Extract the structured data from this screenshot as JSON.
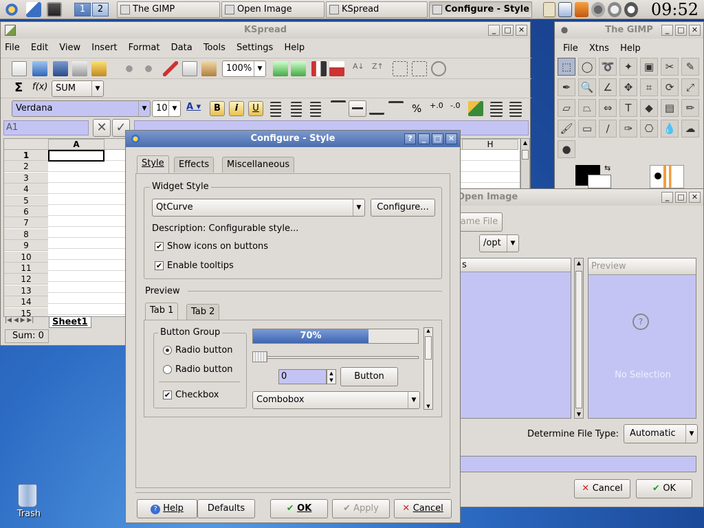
{
  "taskbar": {
    "desktops": [
      "1",
      "2"
    ],
    "tasks": [
      "The GIMP",
      "Open Image",
      "KSpread",
      "Configure - Style"
    ],
    "clock": "09:52"
  },
  "kspread": {
    "title": "KSpread",
    "menu": [
      "File",
      "Edit",
      "View",
      "Insert",
      "Format",
      "Data",
      "Tools",
      "Settings",
      "Help"
    ],
    "zoom": "100%",
    "function": "SUM",
    "font": "Verdana",
    "font_size": "10",
    "bold": "B",
    "italic": "i",
    "underline": "U",
    "percent": "%",
    "cell_ref": "A1",
    "columns": [
      "A",
      "H"
    ],
    "rows": [
      "1",
      "2",
      "3",
      "4",
      "5",
      "6",
      "7",
      "8",
      "9",
      "10",
      "11",
      "12",
      "13",
      "14",
      "15"
    ],
    "sheet_tab": "Sheet1",
    "status": "Sum: 0"
  },
  "gimp": {
    "title": "The GIMP",
    "menu": [
      "File",
      "Xtns",
      "Help"
    ]
  },
  "open_image": {
    "title": "Open Image",
    "rename_btn": "ame File",
    "path_combo": "/opt",
    "list_header": "s",
    "preview_header": "Preview",
    "no_selection": "No Selection",
    "file_type_label": "Determine File Type:",
    "file_type_value": "Automatic",
    "cancel": "Cancel",
    "ok": "OK"
  },
  "configure": {
    "title": "Configure - Style",
    "tabs": [
      "Style",
      "Effects",
      "Miscellaneous"
    ],
    "widget_style_group": "Widget Style",
    "style_value": "QtCurve",
    "configure_btn": "Configure...",
    "description": "Description: Configurable style...",
    "show_icons": "Show icons on buttons",
    "enable_tooltips": "Enable tooltips",
    "preview_label": "Preview",
    "preview_tabs": [
      "Tab 1",
      "Tab 2"
    ],
    "button_group": "Button Group",
    "radio1": "Radio button",
    "radio2": "Radio button",
    "checkbox": "Checkbox",
    "progress": "70%",
    "progress_value": 0.7,
    "spin_value": "0",
    "button": "Button",
    "combobox": "Combobox",
    "help": "Help",
    "defaults": "Defaults",
    "ok": "OK",
    "apply": "Apply",
    "cancel": "Cancel"
  },
  "desktop": {
    "trash": "Trash"
  }
}
